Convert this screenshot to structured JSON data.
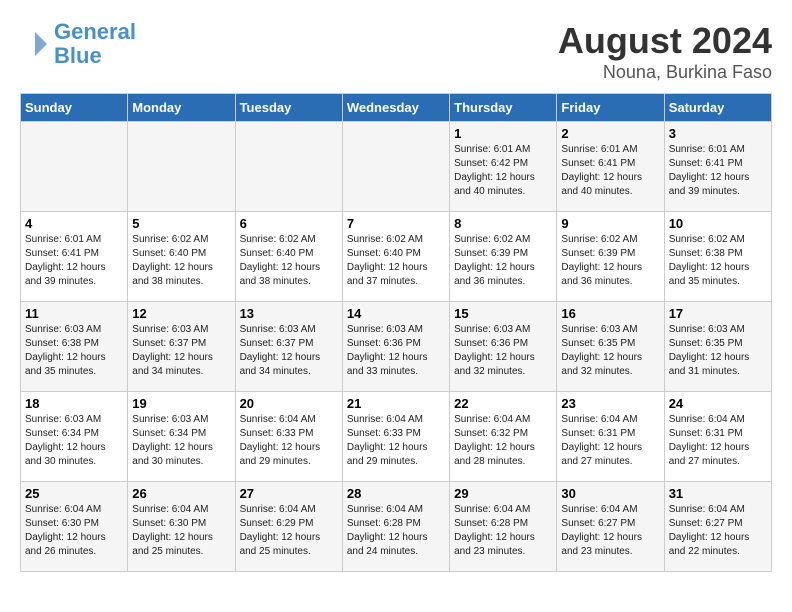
{
  "header": {
    "logo_line1": "General",
    "logo_line2": "Blue",
    "title": "August 2024",
    "subtitle": "Nouna, Burkina Faso"
  },
  "weekdays": [
    "Sunday",
    "Monday",
    "Tuesday",
    "Wednesday",
    "Thursday",
    "Friday",
    "Saturday"
  ],
  "weeks": [
    [
      {
        "day": "",
        "info": ""
      },
      {
        "day": "",
        "info": ""
      },
      {
        "day": "",
        "info": ""
      },
      {
        "day": "",
        "info": ""
      },
      {
        "day": "1",
        "info": "Sunrise: 6:01 AM\nSunset: 6:42 PM\nDaylight: 12 hours\nand 40 minutes."
      },
      {
        "day": "2",
        "info": "Sunrise: 6:01 AM\nSunset: 6:41 PM\nDaylight: 12 hours\nand 40 minutes."
      },
      {
        "day": "3",
        "info": "Sunrise: 6:01 AM\nSunset: 6:41 PM\nDaylight: 12 hours\nand 39 minutes."
      }
    ],
    [
      {
        "day": "4",
        "info": "Sunrise: 6:01 AM\nSunset: 6:41 PM\nDaylight: 12 hours\nand 39 minutes."
      },
      {
        "day": "5",
        "info": "Sunrise: 6:02 AM\nSunset: 6:40 PM\nDaylight: 12 hours\nand 38 minutes."
      },
      {
        "day": "6",
        "info": "Sunrise: 6:02 AM\nSunset: 6:40 PM\nDaylight: 12 hours\nand 38 minutes."
      },
      {
        "day": "7",
        "info": "Sunrise: 6:02 AM\nSunset: 6:40 PM\nDaylight: 12 hours\nand 37 minutes."
      },
      {
        "day": "8",
        "info": "Sunrise: 6:02 AM\nSunset: 6:39 PM\nDaylight: 12 hours\nand 36 minutes."
      },
      {
        "day": "9",
        "info": "Sunrise: 6:02 AM\nSunset: 6:39 PM\nDaylight: 12 hours\nand 36 minutes."
      },
      {
        "day": "10",
        "info": "Sunrise: 6:02 AM\nSunset: 6:38 PM\nDaylight: 12 hours\nand 35 minutes."
      }
    ],
    [
      {
        "day": "11",
        "info": "Sunrise: 6:03 AM\nSunset: 6:38 PM\nDaylight: 12 hours\nand 35 minutes."
      },
      {
        "day": "12",
        "info": "Sunrise: 6:03 AM\nSunset: 6:37 PM\nDaylight: 12 hours\nand 34 minutes."
      },
      {
        "day": "13",
        "info": "Sunrise: 6:03 AM\nSunset: 6:37 PM\nDaylight: 12 hours\nand 34 minutes."
      },
      {
        "day": "14",
        "info": "Sunrise: 6:03 AM\nSunset: 6:36 PM\nDaylight: 12 hours\nand 33 minutes."
      },
      {
        "day": "15",
        "info": "Sunrise: 6:03 AM\nSunset: 6:36 PM\nDaylight: 12 hours\nand 32 minutes."
      },
      {
        "day": "16",
        "info": "Sunrise: 6:03 AM\nSunset: 6:35 PM\nDaylight: 12 hours\nand 32 minutes."
      },
      {
        "day": "17",
        "info": "Sunrise: 6:03 AM\nSunset: 6:35 PM\nDaylight: 12 hours\nand 31 minutes."
      }
    ],
    [
      {
        "day": "18",
        "info": "Sunrise: 6:03 AM\nSunset: 6:34 PM\nDaylight: 12 hours\nand 30 minutes."
      },
      {
        "day": "19",
        "info": "Sunrise: 6:03 AM\nSunset: 6:34 PM\nDaylight: 12 hours\nand 30 minutes."
      },
      {
        "day": "20",
        "info": "Sunrise: 6:04 AM\nSunset: 6:33 PM\nDaylight: 12 hours\nand 29 minutes."
      },
      {
        "day": "21",
        "info": "Sunrise: 6:04 AM\nSunset: 6:33 PM\nDaylight: 12 hours\nand 29 minutes."
      },
      {
        "day": "22",
        "info": "Sunrise: 6:04 AM\nSunset: 6:32 PM\nDaylight: 12 hours\nand 28 minutes."
      },
      {
        "day": "23",
        "info": "Sunrise: 6:04 AM\nSunset: 6:31 PM\nDaylight: 12 hours\nand 27 minutes."
      },
      {
        "day": "24",
        "info": "Sunrise: 6:04 AM\nSunset: 6:31 PM\nDaylight: 12 hours\nand 27 minutes."
      }
    ],
    [
      {
        "day": "25",
        "info": "Sunrise: 6:04 AM\nSunset: 6:30 PM\nDaylight: 12 hours\nand 26 minutes."
      },
      {
        "day": "26",
        "info": "Sunrise: 6:04 AM\nSunset: 6:30 PM\nDaylight: 12 hours\nand 25 minutes."
      },
      {
        "day": "27",
        "info": "Sunrise: 6:04 AM\nSunset: 6:29 PM\nDaylight: 12 hours\nand 25 minutes."
      },
      {
        "day": "28",
        "info": "Sunrise: 6:04 AM\nSunset: 6:28 PM\nDaylight: 12 hours\nand 24 minutes."
      },
      {
        "day": "29",
        "info": "Sunrise: 6:04 AM\nSunset: 6:28 PM\nDaylight: 12 hours\nand 23 minutes."
      },
      {
        "day": "30",
        "info": "Sunrise: 6:04 AM\nSunset: 6:27 PM\nDaylight: 12 hours\nand 23 minutes."
      },
      {
        "day": "31",
        "info": "Sunrise: 6:04 AM\nSunset: 6:27 PM\nDaylight: 12 hours\nand 22 minutes."
      }
    ]
  ]
}
